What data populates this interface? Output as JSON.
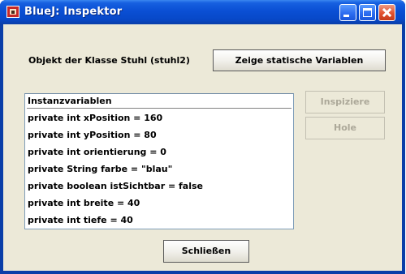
{
  "window": {
    "title": "BlueJ:  Inspektor",
    "controls": {
      "minimize_icon": "minimize-icon",
      "maximize_icon": "maximize-icon",
      "close_icon": "close-icon"
    }
  },
  "inspector": {
    "class_label": "Objekt der Klasse Stuhl (stuhl2)",
    "static_button": "Zeige statische Variablen",
    "inspect_button": "Inspiziere",
    "get_button": "Hole",
    "close_button": "Schließen",
    "list_header": "Instanzvariablen",
    "fields": [
      "private int xPosition = 160",
      "private int yPosition = 80",
      "private int orientierung = 0",
      "private String farbe = \"blau\"",
      "private boolean istSichtbar = false",
      "private int breite = 40",
      "private int tiefe = 40"
    ]
  },
  "colors": {
    "titlebar": "#0a4fd4",
    "client_bg": "#ece9d8",
    "close_button": "#e2512f"
  }
}
